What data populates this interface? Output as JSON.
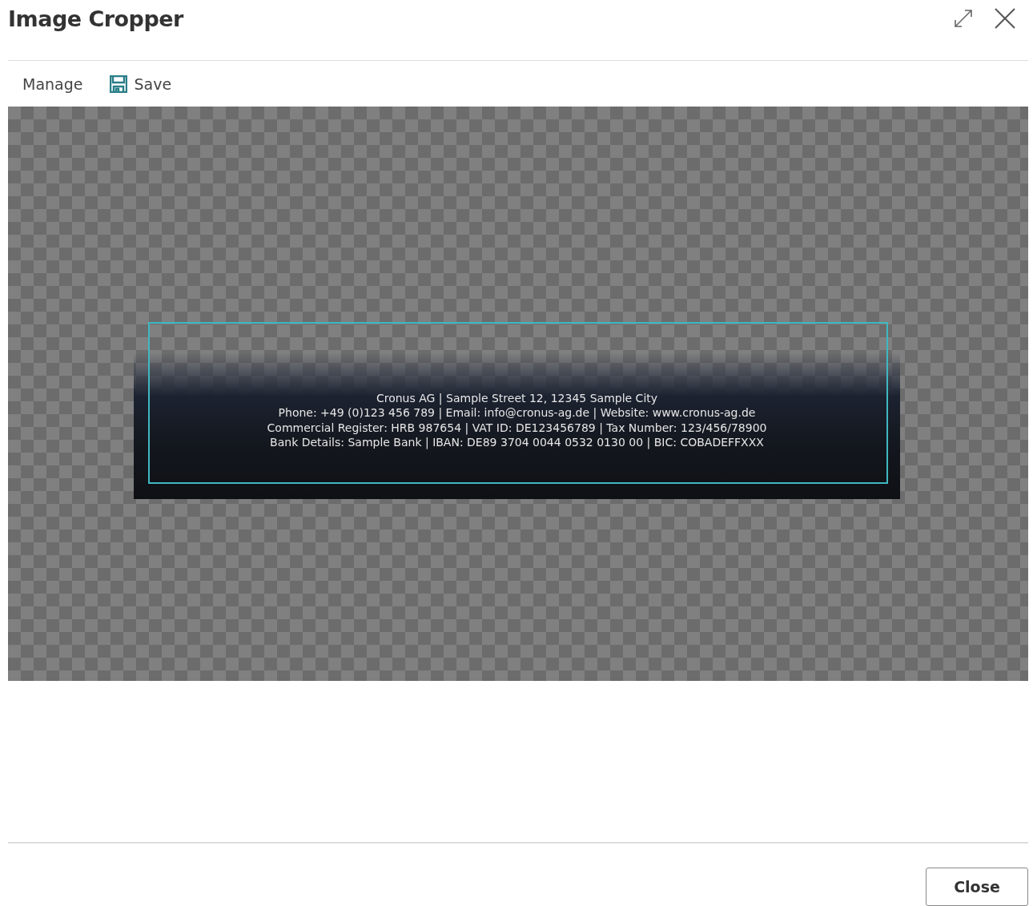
{
  "window": {
    "title": "Image Cropper"
  },
  "toolbar": [
    {
      "label": "Manage",
      "kind": "menu"
    },
    {
      "label": "Save",
      "kind": "save"
    }
  ],
  "image": {
    "lines": [
      "Cronus AG | Sample Street 12, 12345 Sample City",
      "Phone: +49 (0)123 456 789 | Email: info@cronus-ag.de | Website: www.cronus-ag.de",
      "Commercial Register: HRB 987654 | VAT ID: DE123456789 | Tax Number: 123/456/78900",
      "Bank Details: Sample Bank | IBAN: DE89 3704 0044 0532 0130 00 | BIC: COBADEFFXXX"
    ]
  },
  "buttons": [
    "Close"
  ]
}
